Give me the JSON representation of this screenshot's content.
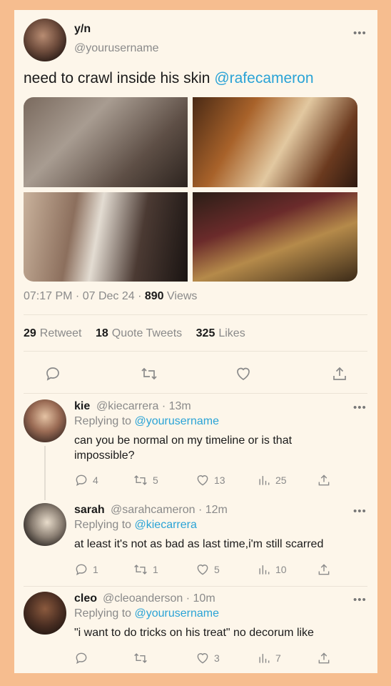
{
  "main": {
    "name": "y/n",
    "handle": "@yourusername",
    "text": "need to crawl inside his skin ",
    "mention": "@rafecameron",
    "time": "07:17 PM · 07 Dec 24 · ",
    "views_count": "890",
    "views_label": " Views",
    "retweets_count": "29",
    "retweets_label": "Retweet",
    "quotes_count": "18",
    "quotes_label": "Quote Tweets",
    "likes_count": "325",
    "likes_label": "Likes"
  },
  "replies": [
    {
      "name": "kie",
      "meta": "@kiecarrera · 13m",
      "replying_label": "Replying to ",
      "replying_to": "@yourusername",
      "text_line1": "can you be normal on my timeline or is that",
      "text_line2": "impossible?",
      "reply_count": "4",
      "retweet_count": "5",
      "like_count": "13",
      "view_count": "25"
    },
    {
      "name": "sarah",
      "meta": "@sarahcameron · 12m",
      "replying_label": "Replying to ",
      "replying_to": "@kiecarrera",
      "text_line1": "at least it's not as bad as last time,i'm still scarred",
      "reply_count": "1",
      "retweet_count": "1",
      "like_count": "5",
      "view_count": "10"
    },
    {
      "name": "cleo",
      "meta": "@cleoanderson · 10m",
      "replying_label": "Replying to ",
      "replying_to": "@yourusername",
      "text_line1": "\"i want to do tricks on his treat\" no decorum like",
      "like_count": "3",
      "view_count": "7"
    }
  ],
  "more_label": "•••",
  "colors": {
    "background": "#f6bd8f",
    "card": "#fdf6ea",
    "link": "#2aa3d6"
  },
  "icons": [
    "reply-icon",
    "retweet-icon",
    "like-icon",
    "share-icon",
    "views-icon",
    "more-icon"
  ]
}
